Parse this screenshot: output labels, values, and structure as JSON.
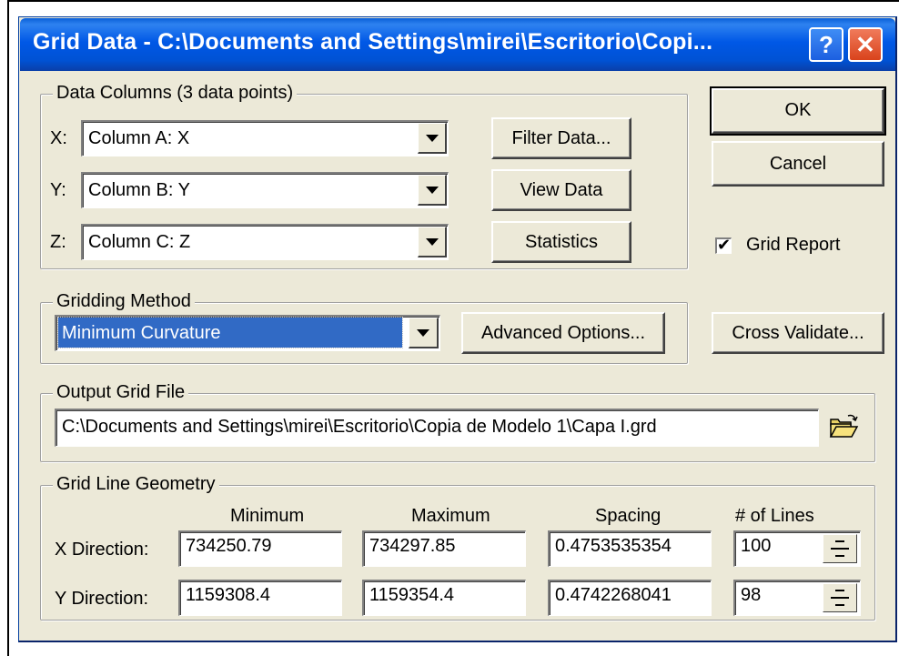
{
  "window": {
    "title": "Grid Data - C:\\Documents and Settings\\mirei\\Escritorio\\Copi...",
    "help_glyph": "?",
    "close_glyph": "✕"
  },
  "data_columns": {
    "legend": "Data Columns    (3 data points)",
    "x_label": "X:",
    "y_label": "Y:",
    "z_label": "Z:",
    "x_value": "Column A:  X",
    "y_value": "Column B:  Y",
    "z_value": "Column C:  Z",
    "filter_button": "Filter Data...",
    "view_button": "View Data",
    "statistics_button": "Statistics"
  },
  "side": {
    "ok_button": "OK",
    "cancel_button": "Cancel",
    "grid_report_label": "Grid Report",
    "grid_report_checked": true,
    "check_glyph": "✔",
    "cross_validate_button": "Cross Validate..."
  },
  "gridding_method": {
    "legend": "Gridding Method",
    "selected": "Minimum Curvature",
    "advanced_button": "Advanced Options..."
  },
  "output": {
    "legend": "Output Grid File",
    "path": "C:\\Documents and Settings\\mirei\\Escritorio\\Copia de Modelo 1\\Capa I.grd",
    "browse_icon": "open-folder-icon"
  },
  "geometry": {
    "legend": "Grid Line Geometry",
    "headers": [
      "Minimum",
      "Maximum",
      "Spacing",
      "# of Lines"
    ],
    "rows": [
      {
        "label": "X Direction:",
        "min": "734250.79",
        "max": "734297.85",
        "spacing": "0.4753535354",
        "lines": "100"
      },
      {
        "label": "Y Direction:",
        "min": "1159308.4",
        "max": "1159354.4",
        "spacing": "0.4742268041",
        "lines": "98"
      }
    ]
  },
  "colors": {
    "title_bar": "#0058e6",
    "dialog_bg": "#ece9d8",
    "selection": "#316ac5"
  }
}
